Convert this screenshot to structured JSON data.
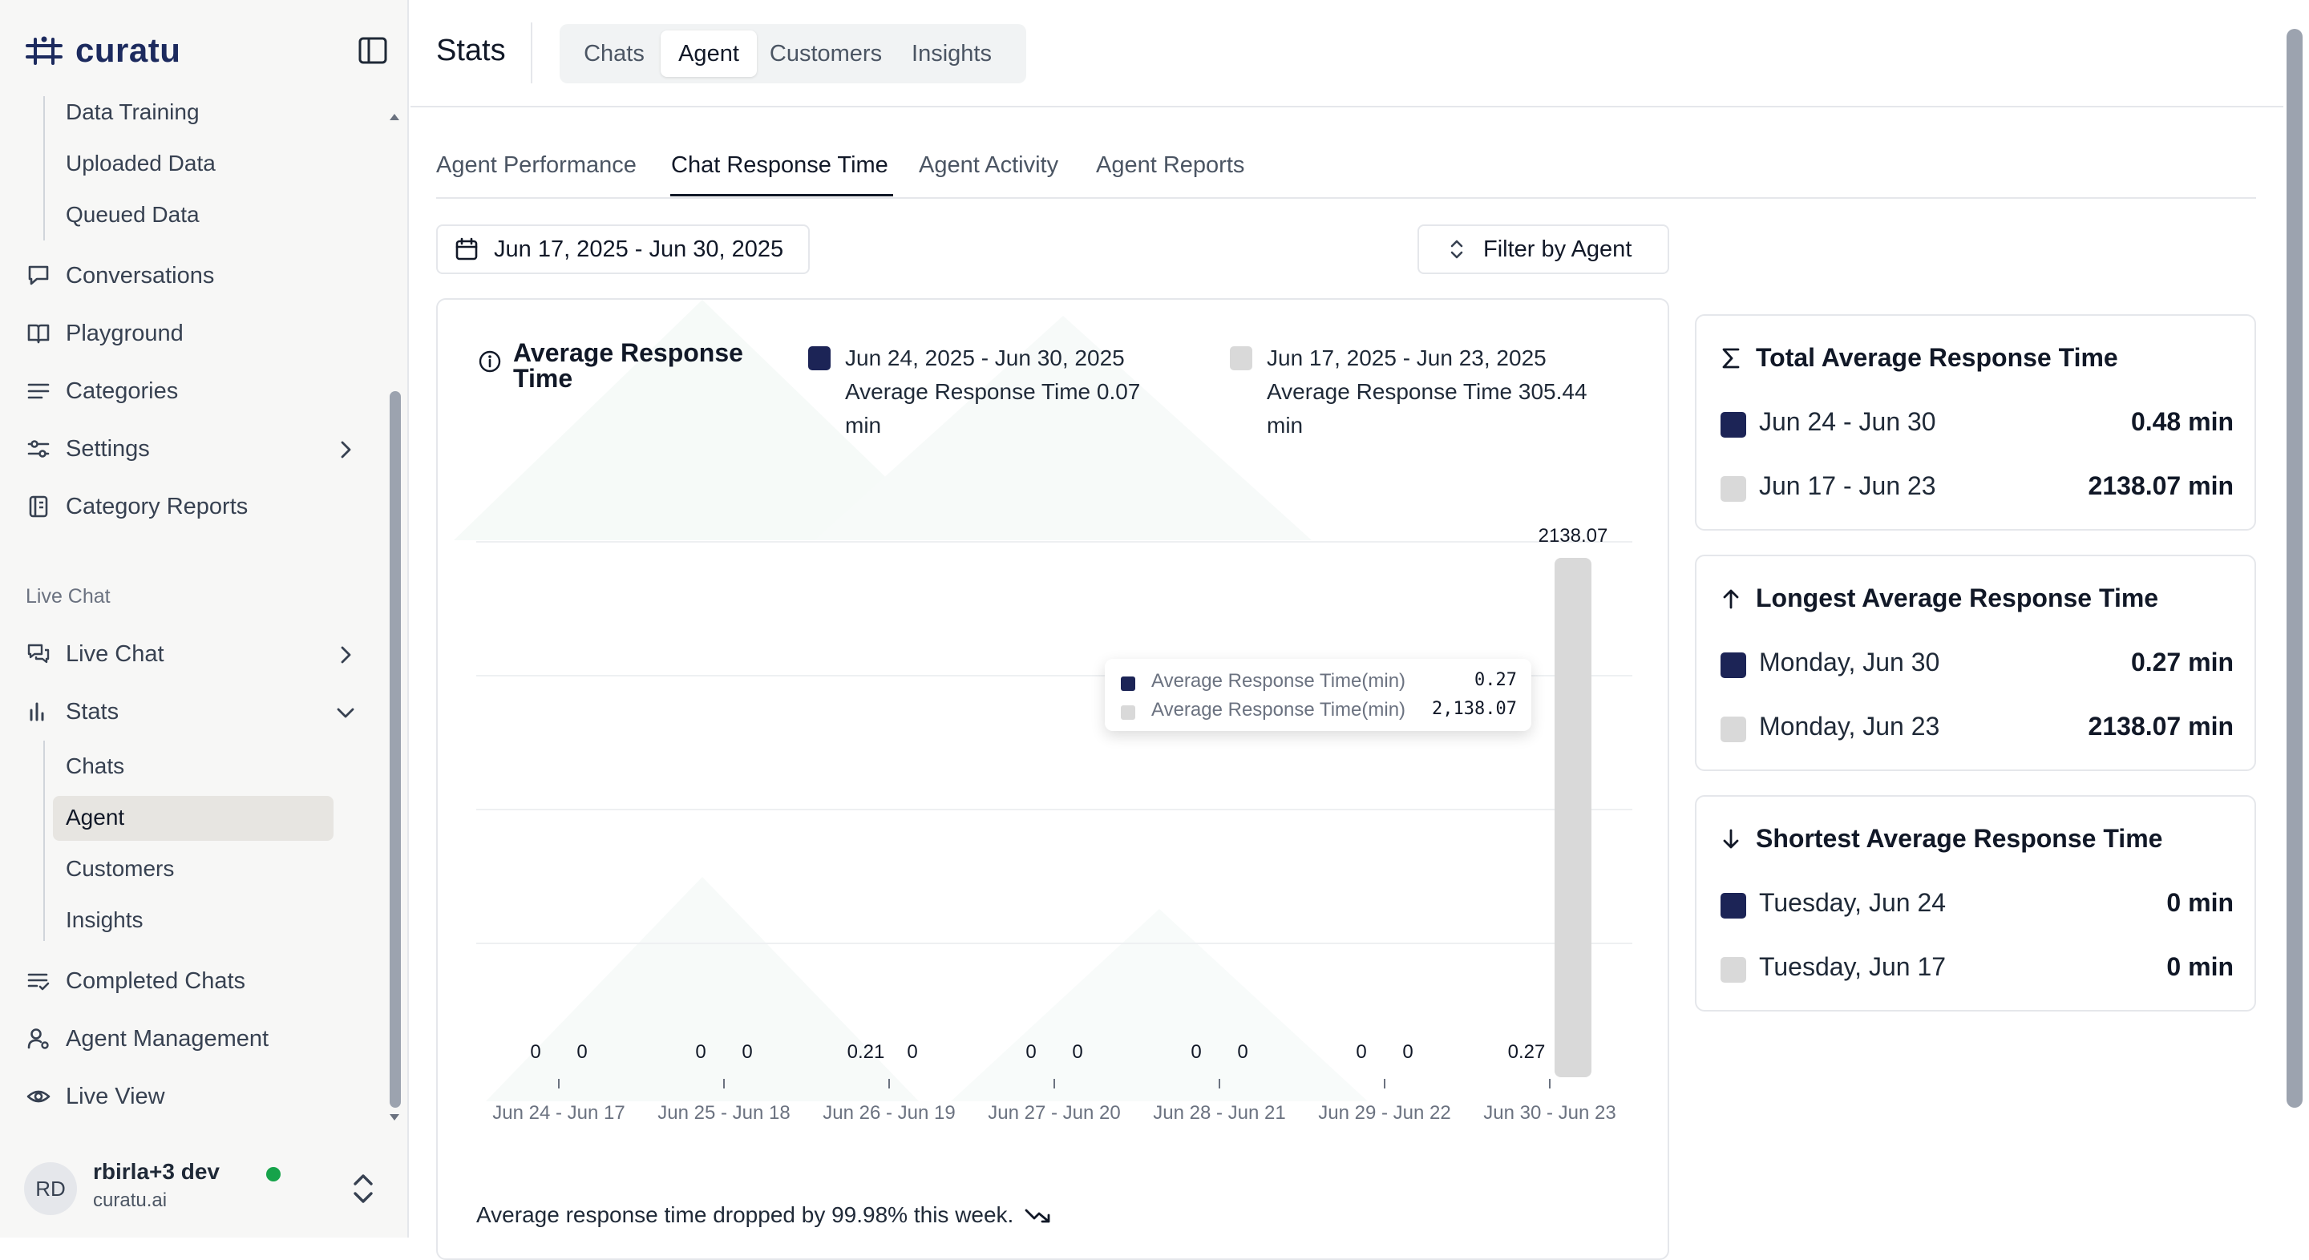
{
  "brand": {
    "name": "curatu"
  },
  "sidebar": {
    "sub_top": [
      "Data Training",
      "Uploaded Data",
      "Queued Data"
    ],
    "items": [
      {
        "label": "Conversations",
        "icon": "conversations-icon"
      },
      {
        "label": "Playground",
        "icon": "book-icon"
      },
      {
        "label": "Categories",
        "icon": "list-icon"
      },
      {
        "label": "Settings",
        "icon": "sliders-icon"
      },
      {
        "label": "Category Reports",
        "icon": "report-icon"
      }
    ],
    "section_label": "Live Chat",
    "live_items": [
      {
        "label": "Live Chat",
        "icon": "chat-icon"
      },
      {
        "label": "Stats",
        "icon": "bar-chart-icon"
      }
    ],
    "stats_sub": [
      "Chats",
      "Agent",
      "Customers",
      "Insights"
    ],
    "bottom_items": [
      {
        "label": "Completed Chats",
        "icon": "completed-list-icon"
      },
      {
        "label": "Agent Management",
        "icon": "user-gear-icon"
      },
      {
        "label": "Live View",
        "icon": "eye-icon"
      }
    ],
    "user": {
      "initials": "RD",
      "name": "rbirla+3 dev",
      "org": "curatu.ai"
    }
  },
  "header": {
    "title": "Stats",
    "tabs": [
      "Chats",
      "Agent",
      "Customers",
      "Insights"
    ],
    "active_tab": "Agent"
  },
  "subtabs": [
    "Agent Performance",
    "Chat Response Time",
    "Agent Activity",
    "Agent Reports"
  ],
  "active_subtab": "Chat Response Time",
  "date_range": "Jun 17, 2025 - Jun 30, 2025",
  "filter_label": "Filter by Agent",
  "chart": {
    "title": "Average Response Time",
    "legend": [
      {
        "range": "Jun 24, 2025 - Jun 30, 2025",
        "line1": "Average Response Time 0.07",
        "line2": "min",
        "color": "#1c2456"
      },
      {
        "range": "Jun 17, 2025 - Jun 23, 2025",
        "line1": "Average Response Time 305.44",
        "line2": "min",
        "color": "#d9d9d9"
      }
    ],
    "tooltip": [
      {
        "label": "Average Response Time(min)",
        "value": "0.27",
        "color": "#1c2456"
      },
      {
        "label": "Average Response Time(min)",
        "value": "2,138.07",
        "color": "#d9d9d9"
      }
    ],
    "trend_text": "Average response time dropped by 99.98% this week."
  },
  "chart_data": {
    "type": "bar",
    "categories": [
      "Jun 24 - Jun 17",
      "Jun 25 - Jun 18",
      "Jun 26 - Jun 19",
      "Jun 27 - Jun 20",
      "Jun 28 - Jun 21",
      "Jun 29 - Jun 22",
      "Jun 30 - Jun 23"
    ],
    "series": [
      {
        "values": [
          0,
          0,
          0.21,
          0,
          0,
          0,
          0.27
        ],
        "labels": [
          "0",
          "0",
          "0.21",
          "0",
          "0",
          "0",
          "0.27"
        ],
        "color": "#1c2456"
      },
      {
        "values": [
          0,
          0,
          0,
          0,
          0,
          0,
          2138.07
        ],
        "labels": [
          "0",
          "0",
          "0",
          "0",
          "0",
          "0",
          "2138.07"
        ],
        "color": "#d9d9d9"
      }
    ],
    "ylim": [
      0,
      2138.07
    ],
    "grid": true
  },
  "stats": [
    {
      "title": "Total Average Response Time",
      "icon": "sigma-icon",
      "rows": [
        {
          "label": "Jun 24 - Jun 30",
          "value": "0.48 min",
          "color": "#1c2456"
        },
        {
          "label": "Jun 17 - Jun 23",
          "value": "2138.07 min",
          "color": "#d9d9d9"
        }
      ]
    },
    {
      "title": "Longest Average Response Time",
      "icon": "arrow-up-icon",
      "rows": [
        {
          "label": "Monday, Jun 30",
          "value": "0.27 min",
          "color": "#1c2456"
        },
        {
          "label": "Monday, Jun 23",
          "value": "2138.07 min",
          "color": "#d9d9d9"
        }
      ]
    },
    {
      "title": "Shortest Average Response Time",
      "icon": "arrow-down-icon",
      "rows": [
        {
          "label": "Tuesday, Jun 24",
          "value": "0 min",
          "color": "#1c2456"
        },
        {
          "label": "Tuesday, Jun 17",
          "value": "0 min",
          "color": "#d9d9d9"
        }
      ]
    }
  ]
}
